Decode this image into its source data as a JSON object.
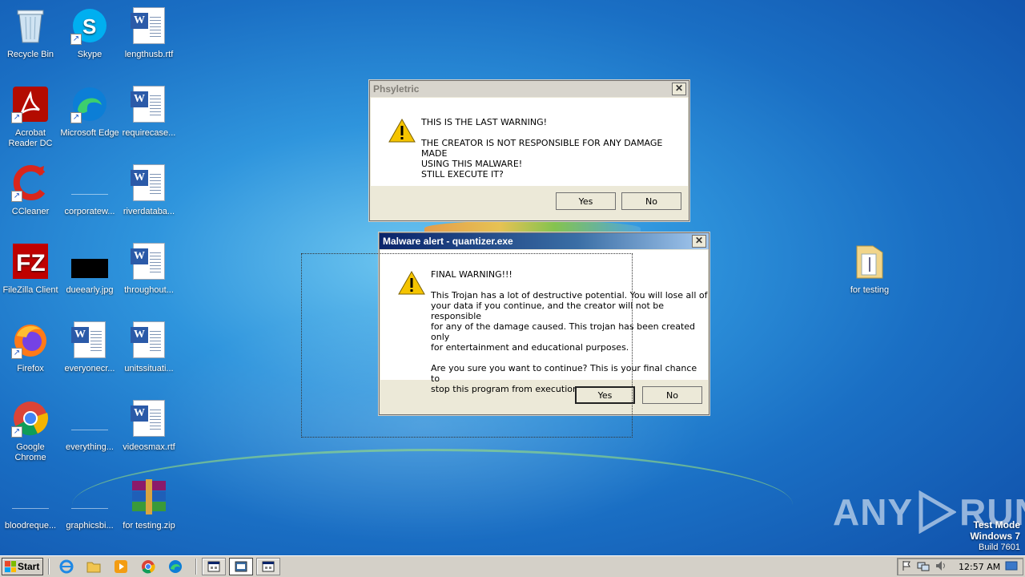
{
  "desktop_icons": [
    {
      "label": "Recycle Bin",
      "icon": "recycle-bin-icon"
    },
    {
      "label": "Skype",
      "icon": "skype-icon"
    },
    {
      "label": "lengthusb.rtf",
      "icon": "word-document-icon"
    },
    {
      "label": "Acrobat Reader DC",
      "icon": "acrobat-icon"
    },
    {
      "label": "Microsoft Edge",
      "icon": "edge-icon"
    },
    {
      "label": "requirecase...",
      "icon": "word-document-icon"
    },
    {
      "label": "CCleaner",
      "icon": "ccleaner-icon"
    },
    {
      "label": "corporatew...",
      "icon": "blank-file-icon"
    },
    {
      "label": "riverdataba...",
      "icon": "word-document-icon"
    },
    {
      "label": "FileZilla Client",
      "icon": "filezilla-icon"
    },
    {
      "label": "dueearly.jpg",
      "icon": "image-file-icon"
    },
    {
      "label": "throughout...",
      "icon": "word-document-icon"
    },
    {
      "label": "Firefox",
      "icon": "firefox-icon"
    },
    {
      "label": "everyonecr...",
      "icon": "word-document-icon"
    },
    {
      "label": "unitssituati...",
      "icon": "word-document-icon"
    },
    {
      "label": "Google Chrome",
      "icon": "chrome-icon"
    },
    {
      "label": "everything...",
      "icon": "blank-file-icon"
    },
    {
      "label": "videosmax.rtf",
      "icon": "word-document-icon"
    },
    {
      "label": "bloodreque...",
      "icon": "blank-file-icon"
    },
    {
      "label": "graphicsbi...",
      "icon": "blank-file-icon"
    },
    {
      "label": "for testing.zip",
      "icon": "winrar-archive-icon"
    },
    {
      "label": "for testing",
      "icon": "folder-icon"
    }
  ],
  "dialog_back": {
    "title": "Phsyletric",
    "line1": "THIS IS THE LAST WARNING!",
    "line2": "THE CREATOR IS NOT RESPONSIBLE FOR ANY DAMAGE MADE",
    "line3": "USING THIS MALWARE!",
    "line4": "STILL EXECUTE IT?",
    "yes": "Yes",
    "no": "No"
  },
  "dialog_front": {
    "title": "Malware alert - quantizer.exe",
    "heading": "FINAL WARNING!!!",
    "p1_l1": "This Trojan has a lot of destructive potential. You will lose all of",
    "p1_l2": "your data if you continue, and the creator will not be responsible",
    "p1_l3": "for any of the damage caused. This trojan has been created only",
    "p1_l4": "for entertainment and educational purposes.",
    "p2_l1": "Are you sure you want to continue? This is your final chance to",
    "p2_l2": "stop this program from execution.",
    "yes": "Yes",
    "no": "No"
  },
  "watermark": {
    "left": "ANY",
    "right": "RUN"
  },
  "system": {
    "mode": "Test Mode",
    "os": "Windows 7",
    "build": "Build 7601"
  },
  "taskbar": {
    "start_label": "Start",
    "clock": "12:57 AM"
  },
  "colors": {
    "title_active": "#0a246a",
    "title_inactive": "#d8d5cd",
    "dialog_face": "#ece9d8"
  }
}
